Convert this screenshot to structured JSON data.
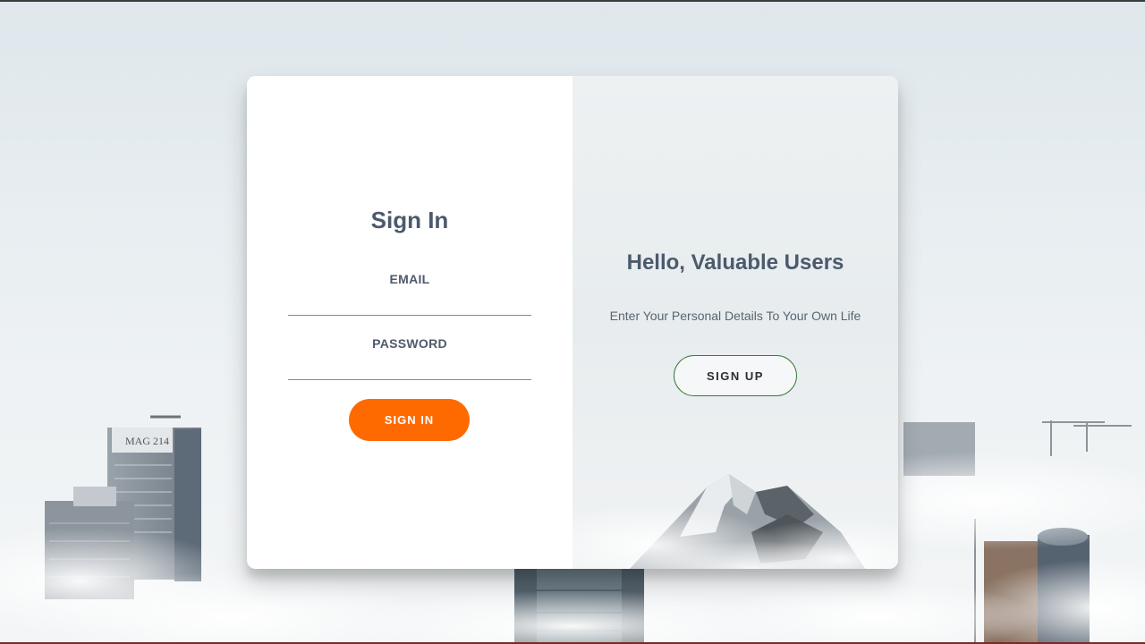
{
  "sign_in": {
    "title": "Sign In",
    "email_label": "EMAIL",
    "email_value": "",
    "password_label": "PASSWORD",
    "password_value": "",
    "submit_label": "SIGN IN"
  },
  "welcome": {
    "title": "Hello, Valuable Users",
    "text": "Enter Your Personal Details To Your Own Life",
    "signup_label": "SIGN UP"
  },
  "background": {
    "building_sign": "MAG 214"
  },
  "colors": {
    "accent_orange": "#ff6a00",
    "signup_border_green": "#3c7a3c",
    "heading_slate": "#4b5a6c"
  }
}
